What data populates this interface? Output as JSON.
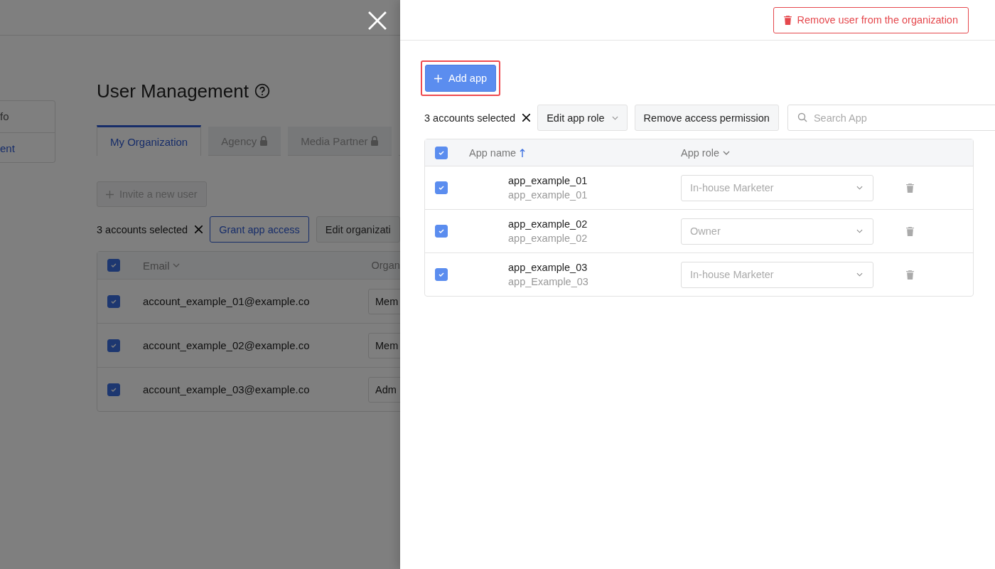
{
  "background": {
    "sidebar": {
      "items": [
        {
          "label": "fo",
          "selected": false
        },
        {
          "label": "ent",
          "selected": true
        }
      ]
    },
    "title": "User Management",
    "tabs": [
      {
        "label": "My Organization",
        "selected": true,
        "locked": false
      },
      {
        "label": "Agency",
        "selected": false,
        "locked": true
      },
      {
        "label": "Media Partner",
        "selected": false,
        "locked": true
      }
    ],
    "invite_button": "Invite a new user",
    "selection": {
      "count_text": "3 accounts selected",
      "actions": [
        {
          "label": "Grant app access",
          "primary": true
        },
        {
          "label": "Edit organizati",
          "primary": false
        }
      ]
    },
    "table": {
      "columns": [
        "Email",
        "Organ"
      ],
      "all_checked": true,
      "rows": [
        {
          "checked": true,
          "email": "account_example_01@example.co",
          "role": "Mem"
        },
        {
          "checked": true,
          "email": "account_example_02@example.co",
          "role": "Mem"
        },
        {
          "checked": true,
          "email": "account_example_03@example.co",
          "role": "Adm"
        }
      ]
    }
  },
  "drawer": {
    "remove_button": "Remove user from the organization",
    "add_app_button": "Add app",
    "selection": {
      "count_text": "3 accounts selected",
      "actions": [
        {
          "label": "Edit app role",
          "kind": "dropdown"
        },
        {
          "label": "Remove access permission",
          "kind": "button"
        }
      ]
    },
    "search": {
      "placeholder": "Search App"
    },
    "table": {
      "columns": [
        {
          "label": "App name",
          "kind": "sortable"
        },
        {
          "label": "App role",
          "kind": "menu"
        }
      ],
      "all_checked": true,
      "rows": [
        {
          "checked": true,
          "name": "app_example_01",
          "subtitle": "app_example_01",
          "role": "In-house Marketer"
        },
        {
          "checked": true,
          "name": "app_example_02",
          "subtitle": "app_example_02",
          "role": "Owner"
        },
        {
          "checked": true,
          "name": "app_example_03",
          "subtitle": "app_Example_03",
          "role": "In-house Marketer"
        }
      ]
    }
  }
}
